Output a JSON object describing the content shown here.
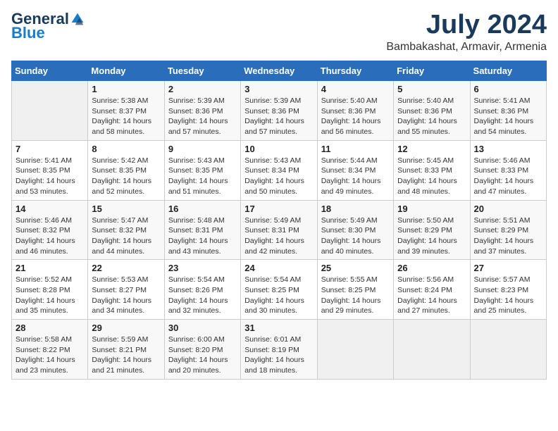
{
  "header": {
    "logo_general": "General",
    "logo_blue": "Blue",
    "month_year": "July 2024",
    "location": "Bambakashat, Armavir, Armenia"
  },
  "calendar": {
    "days_of_week": [
      "Sunday",
      "Monday",
      "Tuesday",
      "Wednesday",
      "Thursday",
      "Friday",
      "Saturday"
    ],
    "weeks": [
      [
        {
          "day": "",
          "empty": true
        },
        {
          "day": "1",
          "sunrise": "5:38 AM",
          "sunset": "8:37 PM",
          "daylight": "14 hours and 58 minutes."
        },
        {
          "day": "2",
          "sunrise": "5:39 AM",
          "sunset": "8:36 PM",
          "daylight": "14 hours and 57 minutes."
        },
        {
          "day": "3",
          "sunrise": "5:39 AM",
          "sunset": "8:36 PM",
          "daylight": "14 hours and 57 minutes."
        },
        {
          "day": "4",
          "sunrise": "5:40 AM",
          "sunset": "8:36 PM",
          "daylight": "14 hours and 56 minutes."
        },
        {
          "day": "5",
          "sunrise": "5:40 AM",
          "sunset": "8:36 PM",
          "daylight": "14 hours and 55 minutes."
        },
        {
          "day": "6",
          "sunrise": "5:41 AM",
          "sunset": "8:36 PM",
          "daylight": "14 hours and 54 minutes."
        }
      ],
      [
        {
          "day": "7",
          "sunrise": "5:41 AM",
          "sunset": "8:35 PM",
          "daylight": "14 hours and 53 minutes."
        },
        {
          "day": "8",
          "sunrise": "5:42 AM",
          "sunset": "8:35 PM",
          "daylight": "14 hours and 52 minutes."
        },
        {
          "day": "9",
          "sunrise": "5:43 AM",
          "sunset": "8:35 PM",
          "daylight": "14 hours and 51 minutes."
        },
        {
          "day": "10",
          "sunrise": "5:43 AM",
          "sunset": "8:34 PM",
          "daylight": "14 hours and 50 minutes."
        },
        {
          "day": "11",
          "sunrise": "5:44 AM",
          "sunset": "8:34 PM",
          "daylight": "14 hours and 49 minutes."
        },
        {
          "day": "12",
          "sunrise": "5:45 AM",
          "sunset": "8:33 PM",
          "daylight": "14 hours and 48 minutes."
        },
        {
          "day": "13",
          "sunrise": "5:46 AM",
          "sunset": "8:33 PM",
          "daylight": "14 hours and 47 minutes."
        }
      ],
      [
        {
          "day": "14",
          "sunrise": "5:46 AM",
          "sunset": "8:32 PM",
          "daylight": "14 hours and 46 minutes."
        },
        {
          "day": "15",
          "sunrise": "5:47 AM",
          "sunset": "8:32 PM",
          "daylight": "14 hours and 44 minutes."
        },
        {
          "day": "16",
          "sunrise": "5:48 AM",
          "sunset": "8:31 PM",
          "daylight": "14 hours and 43 minutes."
        },
        {
          "day": "17",
          "sunrise": "5:49 AM",
          "sunset": "8:31 PM",
          "daylight": "14 hours and 42 minutes."
        },
        {
          "day": "18",
          "sunrise": "5:49 AM",
          "sunset": "8:30 PM",
          "daylight": "14 hours and 40 minutes."
        },
        {
          "day": "19",
          "sunrise": "5:50 AM",
          "sunset": "8:29 PM",
          "daylight": "14 hours and 39 minutes."
        },
        {
          "day": "20",
          "sunrise": "5:51 AM",
          "sunset": "8:29 PM",
          "daylight": "14 hours and 37 minutes."
        }
      ],
      [
        {
          "day": "21",
          "sunrise": "5:52 AM",
          "sunset": "8:28 PM",
          "daylight": "14 hours and 35 minutes."
        },
        {
          "day": "22",
          "sunrise": "5:53 AM",
          "sunset": "8:27 PM",
          "daylight": "14 hours and 34 minutes."
        },
        {
          "day": "23",
          "sunrise": "5:54 AM",
          "sunset": "8:26 PM",
          "daylight": "14 hours and 32 minutes."
        },
        {
          "day": "24",
          "sunrise": "5:54 AM",
          "sunset": "8:25 PM",
          "daylight": "14 hours and 30 minutes."
        },
        {
          "day": "25",
          "sunrise": "5:55 AM",
          "sunset": "8:25 PM",
          "daylight": "14 hours and 29 minutes."
        },
        {
          "day": "26",
          "sunrise": "5:56 AM",
          "sunset": "8:24 PM",
          "daylight": "14 hours and 27 minutes."
        },
        {
          "day": "27",
          "sunrise": "5:57 AM",
          "sunset": "8:23 PM",
          "daylight": "14 hours and 25 minutes."
        }
      ],
      [
        {
          "day": "28",
          "sunrise": "5:58 AM",
          "sunset": "8:22 PM",
          "daylight": "14 hours and 23 minutes."
        },
        {
          "day": "29",
          "sunrise": "5:59 AM",
          "sunset": "8:21 PM",
          "daylight": "14 hours and 21 minutes."
        },
        {
          "day": "30",
          "sunrise": "6:00 AM",
          "sunset": "8:20 PM",
          "daylight": "14 hours and 20 minutes."
        },
        {
          "day": "31",
          "sunrise": "6:01 AM",
          "sunset": "8:19 PM",
          "daylight": "14 hours and 18 minutes."
        },
        {
          "day": "",
          "empty": true
        },
        {
          "day": "",
          "empty": true
        },
        {
          "day": "",
          "empty": true
        }
      ]
    ]
  }
}
